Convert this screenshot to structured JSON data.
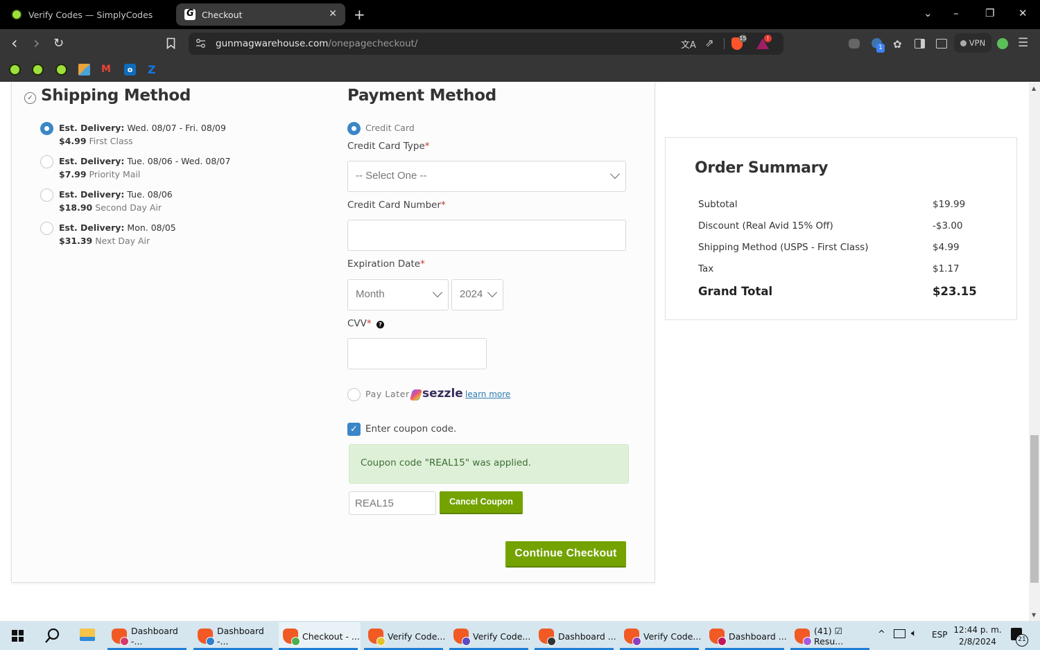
{
  "browser": {
    "tabs": [
      {
        "title": "Verify Codes — SimplyCodes",
        "active": false,
        "icon": "simplycodes-icon"
      },
      {
        "title": "Checkout",
        "active": true,
        "icon": "gunmagwarehouse-icon",
        "close": "✕"
      }
    ],
    "new_tab": "+",
    "window_controls": {
      "tab_search": "⌄",
      "minimize": "–",
      "restore": "❐",
      "close": "✕"
    },
    "nav": {
      "back": "‹",
      "forward": "›",
      "reload": "↻",
      "bookmark": "☐"
    },
    "url": {
      "domain": "gunmagwarehouse.com",
      "path": "/onepagecheckout/"
    },
    "url_actions": {
      "translate": "文A",
      "share": "⇗",
      "brave_shields_badge": "15",
      "rewards_badge": "!"
    },
    "extensions": {
      "profile_badge": "1",
      "vpn_label": "VPN",
      "menu": "☰"
    },
    "bookmarks": [
      "SimplyCodes",
      "SimplyCodes",
      "SimplyCodes",
      "Puzzle app",
      "Gmail",
      "Outlook",
      "Zillow"
    ]
  },
  "shipping": {
    "title": "Shipping Method",
    "delivery_label": "Est. Delivery:",
    "options": [
      {
        "dates": "Wed. 08/07 - Fri. 08/09",
        "price": "$4.99",
        "name": "First Class",
        "selected": true
      },
      {
        "dates": "Tue. 08/06 - Wed. 08/07",
        "price": "$7.99",
        "name": "Priority Mail",
        "selected": false
      },
      {
        "dates": "Tue. 08/06",
        "price": "$18.90",
        "name": "Second Day Air",
        "selected": false
      },
      {
        "dates": "Mon. 08/05",
        "price": "$31.39",
        "name": "Next Day Air",
        "selected": false
      }
    ]
  },
  "payment": {
    "title": "Payment Method",
    "credit_card_label": "Credit Card",
    "card_type_label": "Credit Card Type",
    "card_type_value": "-- Select One --",
    "card_number_label": "Credit Card Number",
    "card_number_value": "",
    "expiration_label": "Expiration Date",
    "month_value": "Month",
    "year_value": "2024",
    "cvv_label": "CVV",
    "cvv_value": "",
    "required_mark": "*",
    "pay_later_label": "Pay Later",
    "sezzle_brand": "sezzle",
    "learn_more": "learn more",
    "coupon_checkbox_label": "Enter coupon code.",
    "coupon_checked": true,
    "coupon_alert": "Coupon code \"REAL15\" was applied.",
    "coupon_value": "REAL15",
    "cancel_coupon": "Cancel Coupon",
    "continue_checkout": "Continue Checkout"
  },
  "summary": {
    "title": "Order Summary",
    "rows": [
      {
        "label": "Subtotal",
        "value": "$19.99"
      },
      {
        "label": "Discount (Real Avid 15% Off)",
        "value": "-$3.00"
      },
      {
        "label": "Shipping Method (USPS - First Class)",
        "value": "$4.99"
      },
      {
        "label": "Tax",
        "value": "$1.17"
      }
    ],
    "total_label": "Grand Total",
    "total_value": "$23.15"
  },
  "colors": {
    "accent_green": "#74a300",
    "radio_blue": "#3b86c6",
    "alert_bg": "#dff0d8"
  },
  "taskbar": {
    "tasks": [
      {
        "label": "Dashboard -...",
        "profile_color": "#d43b6b"
      },
      {
        "label": "Dashboard -...",
        "profile_color": "#2d7fd0"
      },
      {
        "label": "Checkout - ...",
        "profile_color": "#4caf50",
        "active": true
      },
      {
        "label": "Verify Code...",
        "profile_color": "#e6c229"
      },
      {
        "label": "Verify Code...",
        "profile_color": "#5b4bc4"
      },
      {
        "label": "Dashboard ...",
        "profile_color": "#333333"
      },
      {
        "label": "Verify Code...",
        "profile_color": "#8c3fbf"
      },
      {
        "label": "Dashboard ...",
        "profile_color": "#c2185b"
      },
      {
        "label": "(41) ☑ Resu...",
        "profile_color": "#a55be0"
      }
    ],
    "tray": {
      "chevron": "^",
      "language": "ESP",
      "time": "12:44 p. m.",
      "date": "2/8/2024",
      "notifications": "21"
    }
  }
}
